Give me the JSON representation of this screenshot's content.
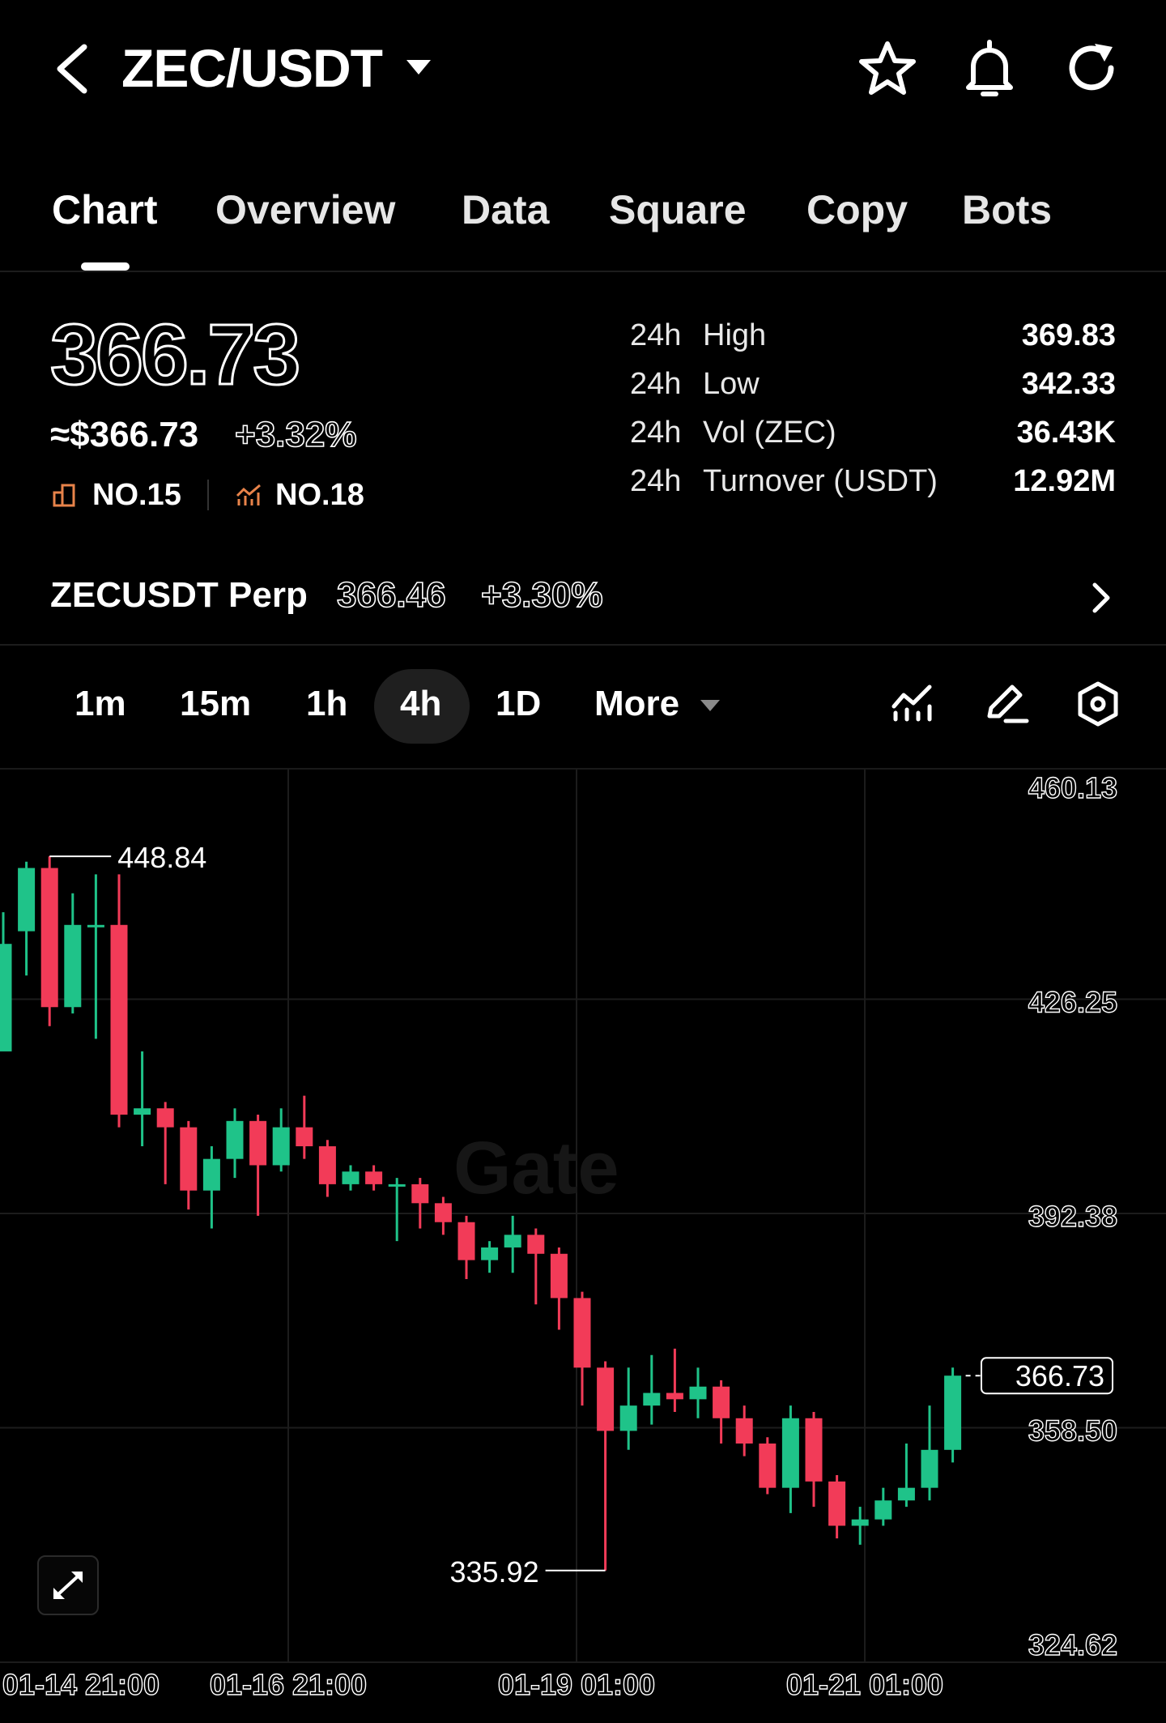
{
  "header": {
    "title": "ZEC/USDT"
  },
  "tabs": [
    {
      "label": "Chart",
      "active": true
    },
    {
      "label": "Overview",
      "active": false
    },
    {
      "label": "Data",
      "active": false
    },
    {
      "label": "Square",
      "active": false
    },
    {
      "label": "Copy",
      "active": false
    },
    {
      "label": "Bots",
      "active": false
    }
  ],
  "price": {
    "last": "366.73",
    "usd": "≈$366.73",
    "change": "+3.32%",
    "rank_volume": "NO.15",
    "rank_gainers": "NO.18"
  },
  "stats": [
    {
      "prefix": "24h",
      "label": "High",
      "value": "369.83"
    },
    {
      "prefix": "24h",
      "label": "Low",
      "value": "342.33"
    },
    {
      "prefix": "24h",
      "label": "Vol (ZEC)",
      "value": "36.43K"
    },
    {
      "prefix": "24h",
      "label": "Turnover (USDT)",
      "value": "12.92M"
    }
  ],
  "perp": {
    "name": "ZECUSDT Perp",
    "price": "366.46",
    "change": "+3.30%"
  },
  "intervals": {
    "items": [
      "1m",
      "15m",
      "1h",
      "4h",
      "1D"
    ],
    "active": "4h",
    "more_label": "More"
  },
  "watermark": "Gate",
  "colors": {
    "up": "#1fc389",
    "down": "#f23b58",
    "accent_rank": "#e8834a",
    "background": "#000000"
  },
  "chart_data": {
    "type": "candlestick",
    "interval": "4h",
    "y_ticks": [
      460.13,
      426.25,
      392.38,
      358.5,
      324.62
    ],
    "ylim": [
      324.62,
      460.13
    ],
    "x_tick_labels": [
      "01-14 21:00",
      "01-16 21:00",
      "01-19 01:00",
      "01-21 01:00"
    ],
    "high_marker": 448.84,
    "low_marker": 335.92,
    "last_price": 366.73,
    "candles": [
      {
        "o": 418,
        "h": 440,
        "l": 425,
        "c": 435
      },
      {
        "o": 437,
        "h": 448,
        "l": 430,
        "c": 447
      },
      {
        "o": 447,
        "h": 448.84,
        "l": 422,
        "c": 425
      },
      {
        "o": 425,
        "h": 443,
        "l": 424,
        "c": 438
      },
      {
        "o": 438,
        "h": 446,
        "l": 420,
        "c": 438
      },
      {
        "o": 438,
        "h": 446,
        "l": 406,
        "c": 408
      },
      {
        "o": 408,
        "h": 418,
        "l": 403,
        "c": 409
      },
      {
        "o": 409,
        "h": 410,
        "l": 397,
        "c": 406
      },
      {
        "o": 406,
        "h": 407,
        "l": 393,
        "c": 396
      },
      {
        "o": 396,
        "h": 403,
        "l": 390,
        "c": 401
      },
      {
        "o": 401,
        "h": 409,
        "l": 398,
        "c": 407
      },
      {
        "o": 407,
        "h": 408,
        "l": 392,
        "c": 400
      },
      {
        "o": 400,
        "h": 409,
        "l": 399,
        "c": 406
      },
      {
        "o": 406,
        "h": 411,
        "l": 401,
        "c": 403
      },
      {
        "o": 403,
        "h": 404,
        "l": 395,
        "c": 397
      },
      {
        "o": 397,
        "h": 400,
        "l": 396,
        "c": 399
      },
      {
        "o": 399,
        "h": 400,
        "l": 396,
        "c": 397
      },
      {
        "o": 397,
        "h": 398,
        "l": 388,
        "c": 397
      },
      {
        "o": 397,
        "h": 398,
        "l": 390,
        "c": 394
      },
      {
        "o": 394,
        "h": 395,
        "l": 389,
        "c": 391
      },
      {
        "o": 391,
        "h": 392,
        "l": 382,
        "c": 385
      },
      {
        "o": 385,
        "h": 388,
        "l": 383,
        "c": 387
      },
      {
        "o": 387,
        "h": 392,
        "l": 383,
        "c": 389
      },
      {
        "o": 389,
        "h": 390,
        "l": 378,
        "c": 386
      },
      {
        "o": 386,
        "h": 387,
        "l": 374,
        "c": 379
      },
      {
        "o": 379,
        "h": 380,
        "l": 362,
        "c": 368
      },
      {
        "o": 368,
        "h": 369,
        "l": 335.92,
        "c": 358
      },
      {
        "o": 358,
        "h": 368,
        "l": 355,
        "c": 362
      },
      {
        "o": 362,
        "h": 370,
        "l": 359,
        "c": 364
      },
      {
        "o": 364,
        "h": 371,
        "l": 361,
        "c": 363
      },
      {
        "o": 363,
        "h": 368,
        "l": 360,
        "c": 365
      },
      {
        "o": 365,
        "h": 366,
        "l": 356,
        "c": 360
      },
      {
        "o": 360,
        "h": 362,
        "l": 354,
        "c": 356
      },
      {
        "o": 356,
        "h": 357,
        "l": 348,
        "c": 349
      },
      {
        "o": 349,
        "h": 362,
        "l": 345,
        "c": 360
      },
      {
        "o": 360,
        "h": 361,
        "l": 346,
        "c": 350
      },
      {
        "o": 350,
        "h": 351,
        "l": 341,
        "c": 343
      },
      {
        "o": 343,
        "h": 346,
        "l": 340,
        "c": 344
      },
      {
        "o": 344,
        "h": 349,
        "l": 343,
        "c": 347
      },
      {
        "o": 347,
        "h": 356,
        "l": 346,
        "c": 349
      },
      {
        "o": 349,
        "h": 362,
        "l": 347,
        "c": 355
      },
      {
        "o": 355,
        "h": 368,
        "l": 353,
        "c": 366.73
      }
    ]
  }
}
